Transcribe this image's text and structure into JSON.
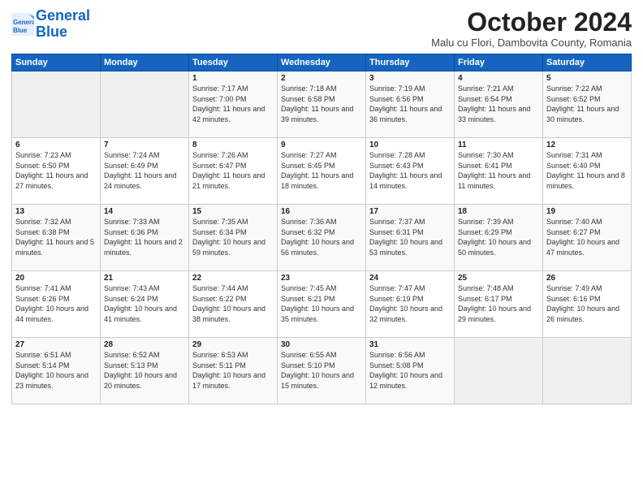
{
  "logo": {
    "line1": "General",
    "line2": "Blue"
  },
  "title": "October 2024",
  "location": "Malu cu Flori, Dambovita County, Romania",
  "days_of_week": [
    "Sunday",
    "Monday",
    "Tuesday",
    "Wednesday",
    "Thursday",
    "Friday",
    "Saturday"
  ],
  "weeks": [
    [
      {
        "num": "",
        "detail": ""
      },
      {
        "num": "",
        "detail": ""
      },
      {
        "num": "1",
        "detail": "Sunrise: 7:17 AM\nSunset: 7:00 PM\nDaylight: 11 hours\nand 42 minutes."
      },
      {
        "num": "2",
        "detail": "Sunrise: 7:18 AM\nSunset: 6:58 PM\nDaylight: 11 hours\nand 39 minutes."
      },
      {
        "num": "3",
        "detail": "Sunrise: 7:19 AM\nSunset: 6:56 PM\nDaylight: 11 hours\nand 36 minutes."
      },
      {
        "num": "4",
        "detail": "Sunrise: 7:21 AM\nSunset: 6:54 PM\nDaylight: 11 hours\nand 33 minutes."
      },
      {
        "num": "5",
        "detail": "Sunrise: 7:22 AM\nSunset: 6:52 PM\nDaylight: 11 hours\nand 30 minutes."
      }
    ],
    [
      {
        "num": "6",
        "detail": "Sunrise: 7:23 AM\nSunset: 6:50 PM\nDaylight: 11 hours\nand 27 minutes."
      },
      {
        "num": "7",
        "detail": "Sunrise: 7:24 AM\nSunset: 6:49 PM\nDaylight: 11 hours\nand 24 minutes."
      },
      {
        "num": "8",
        "detail": "Sunrise: 7:26 AM\nSunset: 6:47 PM\nDaylight: 11 hours\nand 21 minutes."
      },
      {
        "num": "9",
        "detail": "Sunrise: 7:27 AM\nSunset: 6:45 PM\nDaylight: 11 hours\nand 18 minutes."
      },
      {
        "num": "10",
        "detail": "Sunrise: 7:28 AM\nSunset: 6:43 PM\nDaylight: 11 hours\nand 14 minutes."
      },
      {
        "num": "11",
        "detail": "Sunrise: 7:30 AM\nSunset: 6:41 PM\nDaylight: 11 hours\nand 11 minutes."
      },
      {
        "num": "12",
        "detail": "Sunrise: 7:31 AM\nSunset: 6:40 PM\nDaylight: 11 hours\nand 8 minutes."
      }
    ],
    [
      {
        "num": "13",
        "detail": "Sunrise: 7:32 AM\nSunset: 6:38 PM\nDaylight: 11 hours\nand 5 minutes."
      },
      {
        "num": "14",
        "detail": "Sunrise: 7:33 AM\nSunset: 6:36 PM\nDaylight: 11 hours\nand 2 minutes."
      },
      {
        "num": "15",
        "detail": "Sunrise: 7:35 AM\nSunset: 6:34 PM\nDaylight: 10 hours\nand 59 minutes."
      },
      {
        "num": "16",
        "detail": "Sunrise: 7:36 AM\nSunset: 6:32 PM\nDaylight: 10 hours\nand 56 minutes."
      },
      {
        "num": "17",
        "detail": "Sunrise: 7:37 AM\nSunset: 6:31 PM\nDaylight: 10 hours\nand 53 minutes."
      },
      {
        "num": "18",
        "detail": "Sunrise: 7:39 AM\nSunset: 6:29 PM\nDaylight: 10 hours\nand 50 minutes."
      },
      {
        "num": "19",
        "detail": "Sunrise: 7:40 AM\nSunset: 6:27 PM\nDaylight: 10 hours\nand 47 minutes."
      }
    ],
    [
      {
        "num": "20",
        "detail": "Sunrise: 7:41 AM\nSunset: 6:26 PM\nDaylight: 10 hours\nand 44 minutes."
      },
      {
        "num": "21",
        "detail": "Sunrise: 7:43 AM\nSunset: 6:24 PM\nDaylight: 10 hours\nand 41 minutes."
      },
      {
        "num": "22",
        "detail": "Sunrise: 7:44 AM\nSunset: 6:22 PM\nDaylight: 10 hours\nand 38 minutes."
      },
      {
        "num": "23",
        "detail": "Sunrise: 7:45 AM\nSunset: 6:21 PM\nDaylight: 10 hours\nand 35 minutes."
      },
      {
        "num": "24",
        "detail": "Sunrise: 7:47 AM\nSunset: 6:19 PM\nDaylight: 10 hours\nand 32 minutes."
      },
      {
        "num": "25",
        "detail": "Sunrise: 7:48 AM\nSunset: 6:17 PM\nDaylight: 10 hours\nand 29 minutes."
      },
      {
        "num": "26",
        "detail": "Sunrise: 7:49 AM\nSunset: 6:16 PM\nDaylight: 10 hours\nand 26 minutes."
      }
    ],
    [
      {
        "num": "27",
        "detail": "Sunrise: 6:51 AM\nSunset: 5:14 PM\nDaylight: 10 hours\nand 23 minutes."
      },
      {
        "num": "28",
        "detail": "Sunrise: 6:52 AM\nSunset: 5:13 PM\nDaylight: 10 hours\nand 20 minutes."
      },
      {
        "num": "29",
        "detail": "Sunrise: 6:53 AM\nSunset: 5:11 PM\nDaylight: 10 hours\nand 17 minutes."
      },
      {
        "num": "30",
        "detail": "Sunrise: 6:55 AM\nSunset: 5:10 PM\nDaylight: 10 hours\nand 15 minutes."
      },
      {
        "num": "31",
        "detail": "Sunrise: 6:56 AM\nSunset: 5:08 PM\nDaylight: 10 hours\nand 12 minutes."
      },
      {
        "num": "",
        "detail": ""
      },
      {
        "num": "",
        "detail": ""
      }
    ]
  ]
}
